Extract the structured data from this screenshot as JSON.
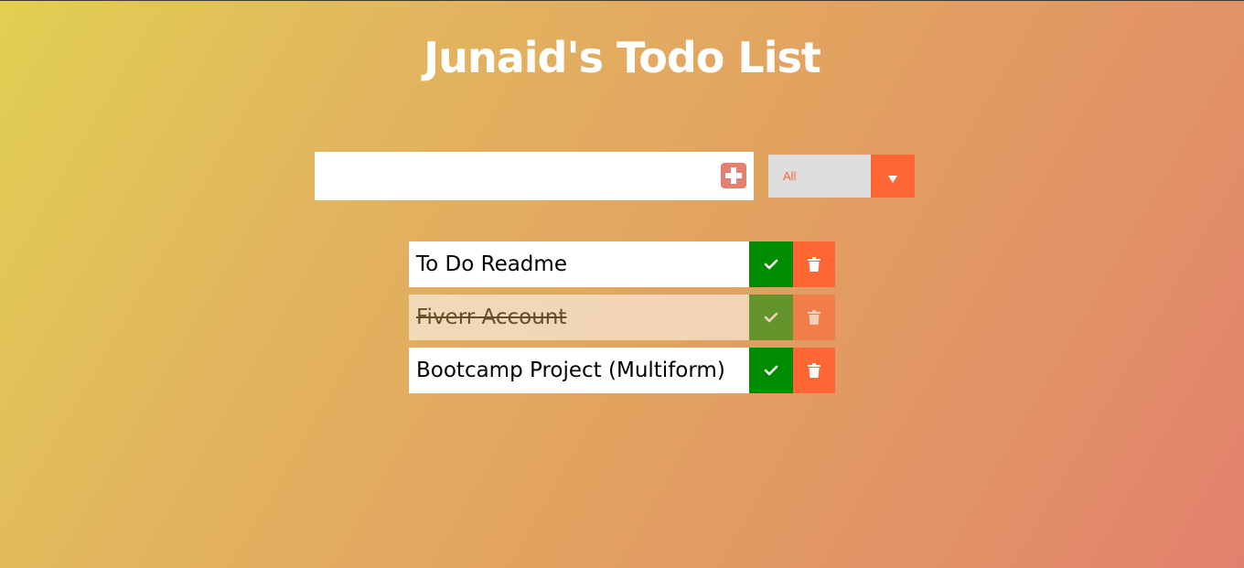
{
  "app": {
    "title": "Junaid's Todo List"
  },
  "input": {
    "value": "",
    "placeholder": ""
  },
  "filter": {
    "selected": "All",
    "options": [
      "All"
    ]
  },
  "todos": [
    {
      "text": "To Do Readme",
      "completed": false
    },
    {
      "text": "Fiverr Account",
      "completed": true
    },
    {
      "text": "Bootcamp Project (Multiform)",
      "completed": false
    }
  ],
  "colors": {
    "accent": "#ff6633",
    "complete": "#008c00",
    "add_button": "#e38170",
    "filter_background": "#dddddd",
    "gradient_start": "#e1cf52",
    "gradient_end": "#e2806d"
  },
  "icons": {
    "add": "plus-square-icon",
    "filter": "triangle-down-icon",
    "complete": "check-icon",
    "delete": "trash-icon"
  }
}
